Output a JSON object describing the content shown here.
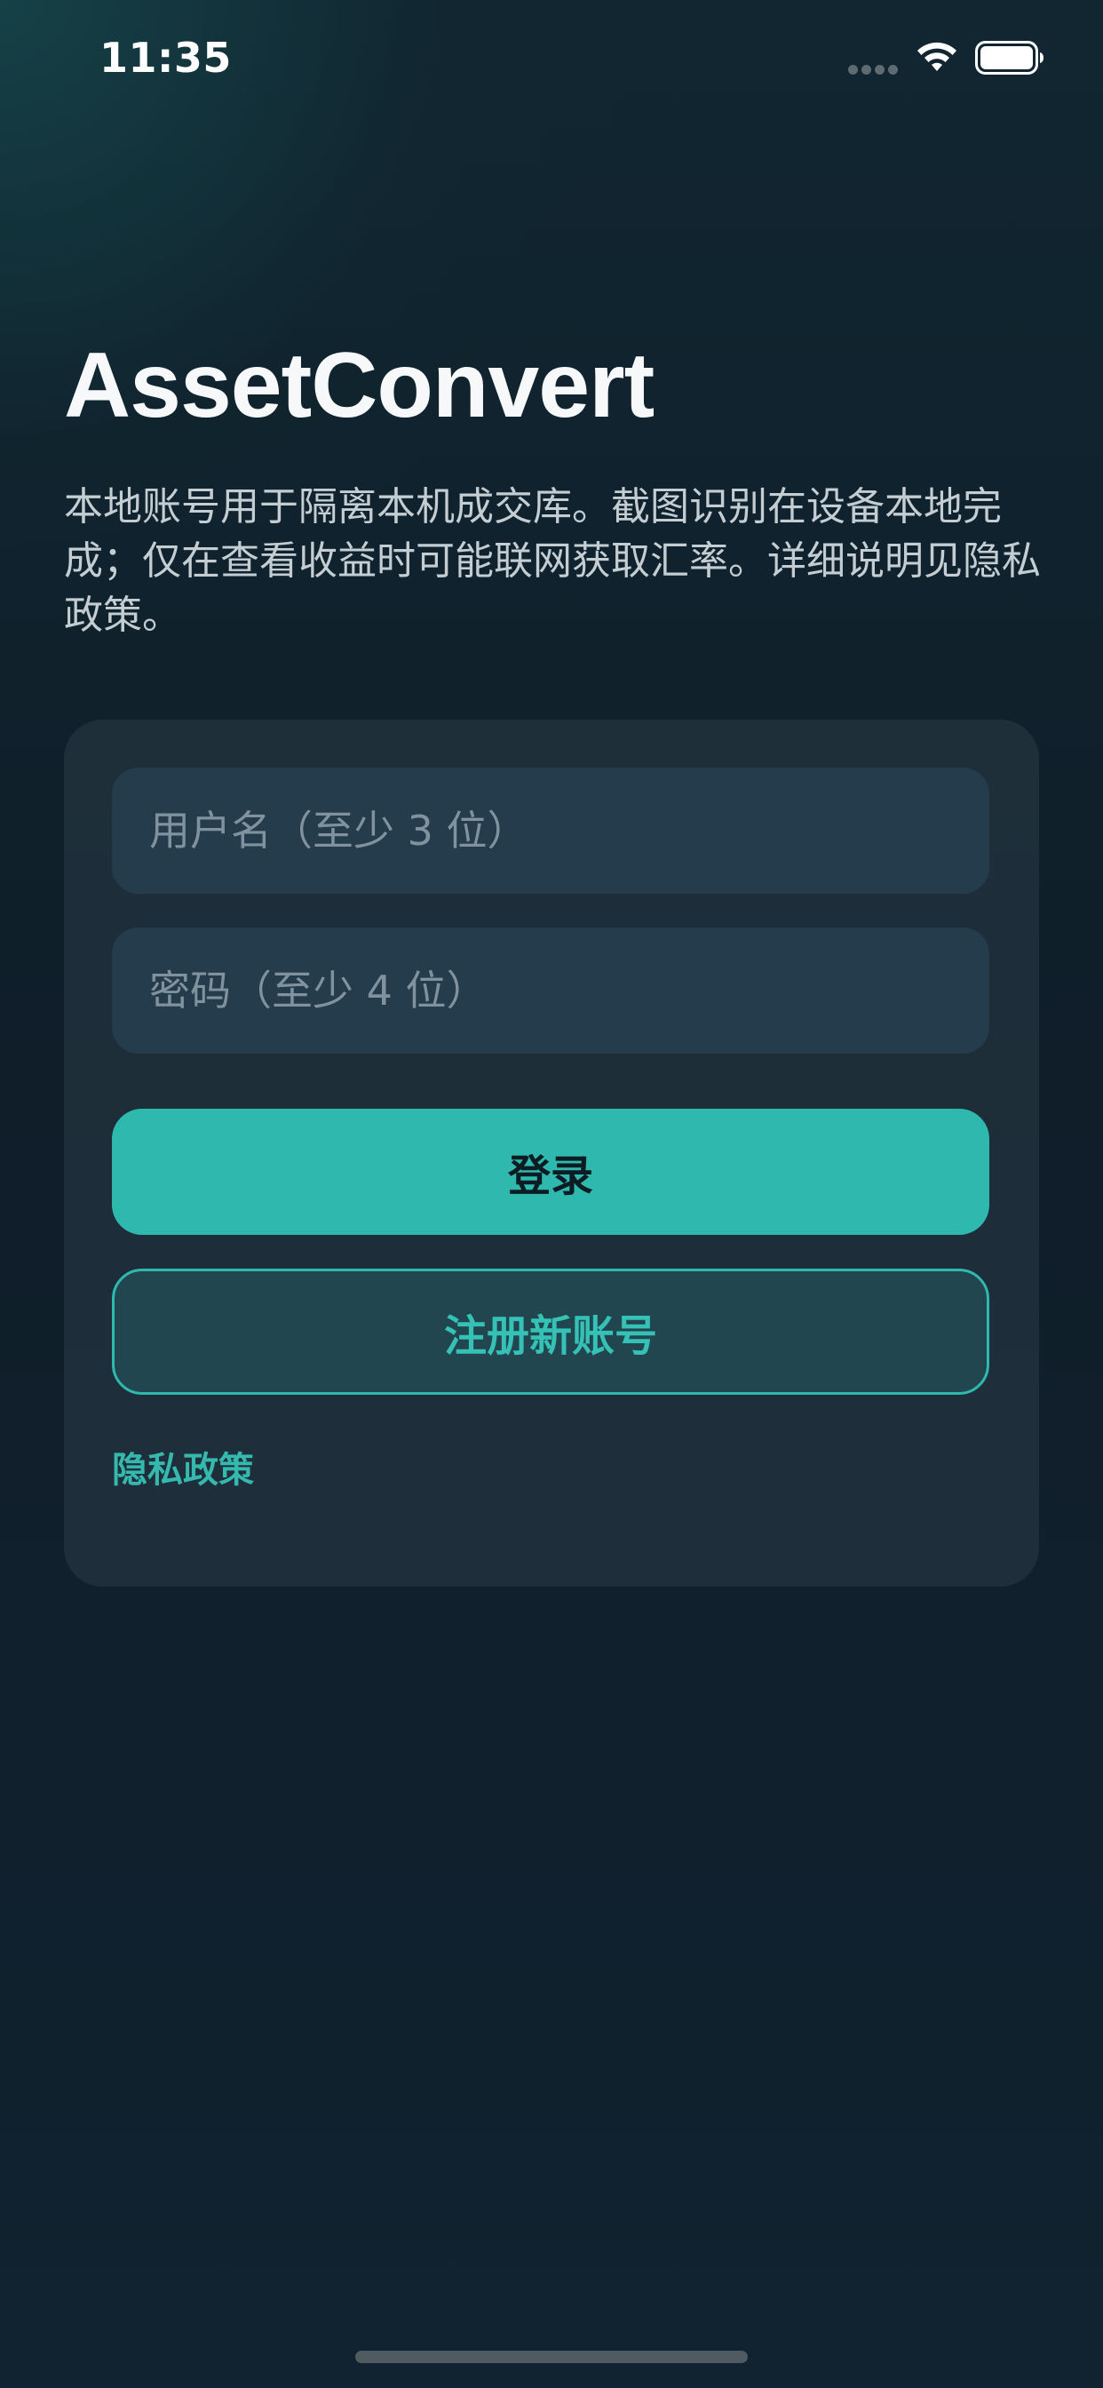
{
  "status_bar": {
    "time": "11:35",
    "icons": [
      "signal-dots-icon",
      "wifi-icon",
      "battery-icon"
    ]
  },
  "header": {
    "title": "AssetConvert",
    "description": "本地账号用于隔离本机成交库。截图识别在设备本地完成；仅在查看收益时可能联网获取汇率。详细说明见隐私政策。"
  },
  "form": {
    "username_placeholder": "用户名（至少 3 位）",
    "username_value": "",
    "password_placeholder": "密码（至少 4 位）",
    "password_value": "",
    "login_label": "登录",
    "register_label": "注册新账号",
    "privacy_link": "隐私政策"
  },
  "colors": {
    "accent": "#2fb8ad",
    "background": "#0f1e29",
    "card": "#1c2c38",
    "field": "#253c4c"
  }
}
